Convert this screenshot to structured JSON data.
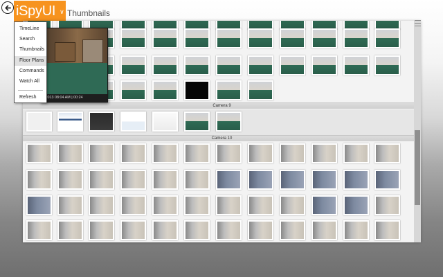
{
  "app": {
    "name": "iSpyUI",
    "page_title": "Thumbnails",
    "brand_color": "#f7931e",
    "back_icon": "back-arrow-icon",
    "dropdown_icon": "chevron-down-icon"
  },
  "menu": {
    "items": [
      {
        "label": "TimeLine",
        "selected": false
      },
      {
        "label": "Search",
        "selected": false
      },
      {
        "label": "Thumbnails",
        "selected": false
      },
      {
        "label": "Floor Plans",
        "selected": true
      },
      {
        "label": "Commands",
        "selected": false
      },
      {
        "label": "Watch All",
        "selected": false
      },
      {
        "label": "Refresh",
        "selected": false
      }
    ]
  },
  "preview": {
    "caption": "0/2013 08:04 AM | 00:24"
  },
  "sections": [
    {
      "label": "Camera 9"
    },
    {
      "label": "Camera 10"
    }
  ]
}
